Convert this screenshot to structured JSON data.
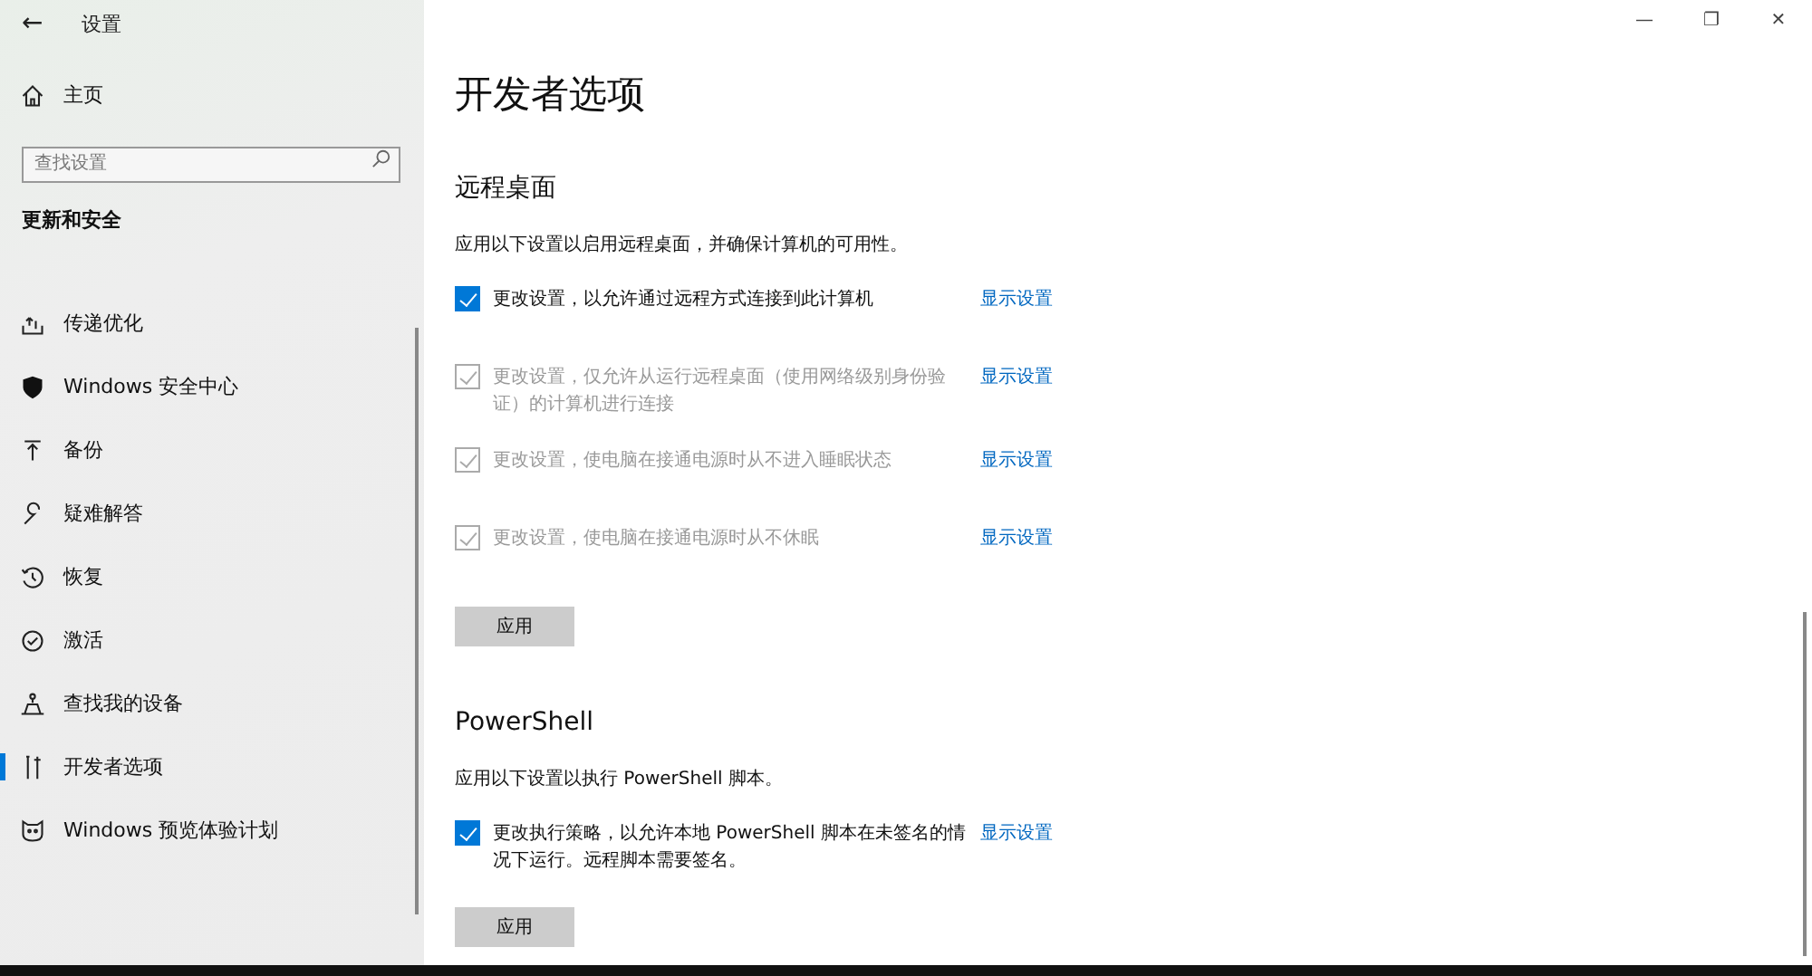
{
  "window": {
    "title": "设置",
    "back": "←",
    "controls": [
      "—",
      "❐",
      "✕"
    ]
  },
  "sidebar": {
    "home": "主页",
    "search": {
      "placeholder": "查找设置"
    },
    "section": "更新和安全",
    "items": [
      {
        "label": "传递优化",
        "selected": false
      },
      {
        "label": "Windows 安全中心",
        "selected": false
      },
      {
        "label": "备份",
        "selected": false
      },
      {
        "label": "疑难解答",
        "selected": false
      },
      {
        "label": "恢复",
        "selected": false
      },
      {
        "label": "激活",
        "selected": false
      },
      {
        "label": "查找我的设备",
        "selected": false
      },
      {
        "label": "开发者选项",
        "selected": true
      },
      {
        "label": "Windows 预览体验计划",
        "selected": false
      }
    ]
  },
  "page_title": "开发者选项",
  "sections": [
    {
      "heading": "远程桌面",
      "description": "应用以下设置以启用远程桌面，并确保计算机的可用性。",
      "options": [
        {
          "label": "更改设置，以允许通过远程方式连接到此计算机",
          "checked": true,
          "disabled": false,
          "link": "显示设置"
        },
        {
          "label": "更改设置，仅允许从运行远程桌面（使用网络级别身份验证）的计算机进行连接",
          "checked": true,
          "disabled": true,
          "link": "显示设置"
        },
        {
          "label": "更改设置，使电脑在接通电源时从不进入睡眠状态",
          "checked": true,
          "disabled": true,
          "link": "显示设置"
        },
        {
          "label": "更改设置，使电脑在接通电源时从不休眠",
          "checked": true,
          "disabled": true,
          "link": "显示设置"
        }
      ],
      "button": "应用"
    },
    {
      "heading": "PowerShell",
      "description": "应用以下设置以执行 PowerShell 脚本。",
      "options": [
        {
          "label": "更改执行策略，以允许本地 PowerShell 脚本在未签名的情况下运行。远程脚本需要签名。",
          "checked": true,
          "disabled": false,
          "link": "显示设置"
        }
      ],
      "button": "应用"
    }
  ]
}
